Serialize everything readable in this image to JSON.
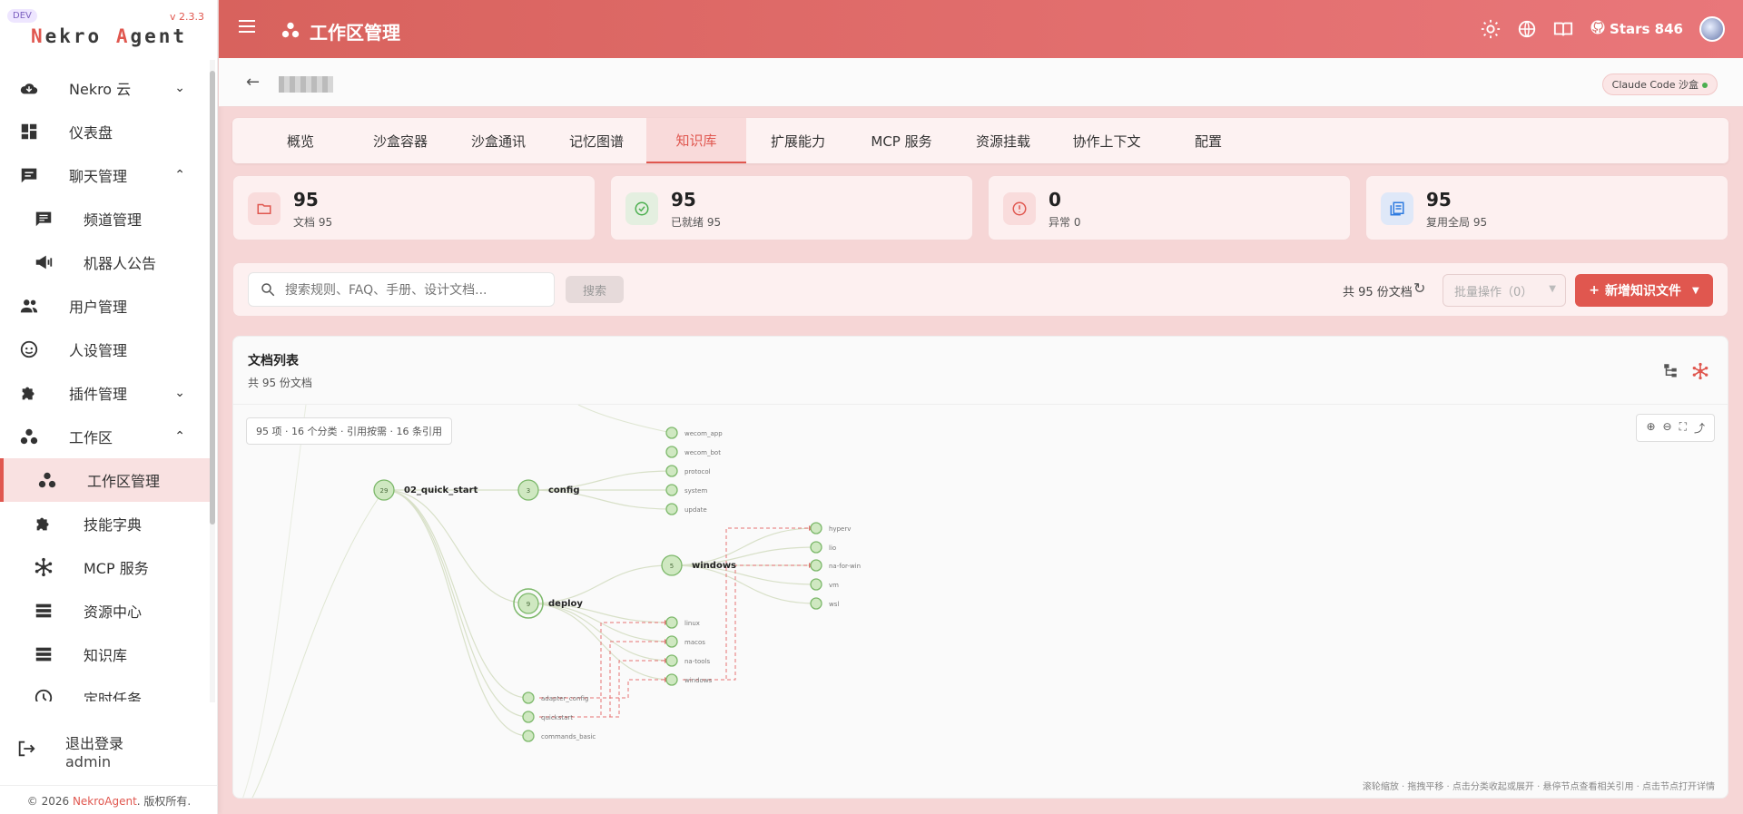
{
  "sidebar": {
    "dev_badge": "DEV",
    "version": "v 2.3.3",
    "brand_a": "N",
    "brand_b": "ekro ",
    "brand_c": "A",
    "brand_d": "gent",
    "items": [
      {
        "label": "Nekro 云",
        "icon": "cloud-download-icon",
        "chevron": "⌄"
      },
      {
        "label": "仪表盘",
        "icon": "dashboard-icon"
      },
      {
        "label": "聊天管理",
        "icon": "chat-icon",
        "chevron": "⌃"
      },
      {
        "label": "频道管理",
        "icon": "channel-icon"
      },
      {
        "label": "机器人公告",
        "icon": "megaphone-icon"
      },
      {
        "label": "用户管理",
        "icon": "users-icon"
      },
      {
        "label": "人设管理",
        "icon": "face-icon"
      },
      {
        "label": "插件管理",
        "icon": "puzzle-icon",
        "chevron": "⌄"
      },
      {
        "label": "工作区",
        "icon": "workspace-icon",
        "chevron": "⌃"
      },
      {
        "label": "工作区管理",
        "icon": "workspace-icon"
      },
      {
        "label": "技能字典",
        "icon": "puzzle-icon"
      },
      {
        "label": "MCP 服务",
        "icon": "hub-icon"
      },
      {
        "label": "资源中心",
        "icon": "list-icon"
      },
      {
        "label": "知识库",
        "icon": "list-icon"
      },
      {
        "label": "定时任务",
        "icon": "clock-icon"
      }
    ],
    "logout_label": "退出登录",
    "user": "admin",
    "footer_prefix": "© 2026 ",
    "footer_brand": "NekroAgent",
    "footer_suffix": ". 版权所有."
  },
  "header": {
    "title": "工作区管理",
    "stars": "Stars 846"
  },
  "subbar": {
    "badge": "Claude Code 沙盒"
  },
  "tabs": [
    "概览",
    "沙盒容器",
    "沙盒通讯",
    "记忆图谱",
    "知识库",
    "扩展能力",
    "MCP 服务",
    "资源挂载",
    "协作上下文",
    "配置"
  ],
  "active_tab": 4,
  "stats": [
    {
      "num": "95",
      "sub": "文档 95",
      "color": "#e0574f",
      "bg": "#f9dcdc"
    },
    {
      "num": "95",
      "sub": "已就绪 95",
      "color": "#4caf50",
      "bg": "#e4efe0"
    },
    {
      "num": "0",
      "sub": "异常 0",
      "color": "#e0574f",
      "bg": "#f9dcdc"
    },
    {
      "num": "95",
      "sub": "复用全局 95",
      "color": "#2f7be0",
      "bg": "#dfe8f8"
    }
  ],
  "search": {
    "placeholder": "搜索规则、FAQ、手册、设计文档...",
    "button": "搜索",
    "count": "共 95 份文档",
    "batch": "批量操作（0）",
    "new_button": "新增知识文件"
  },
  "panel": {
    "title": "文档列表",
    "subtitle": "共 95 份文档",
    "chip": "95 项 · 16 个分类 · 引用按需 · 16 条引用",
    "hint": "滚轮缩放 · 拖拽平移 · 点击分类收起或展开 · 悬停节点查看相关引用 · 点击节点打开详情"
  },
  "graph": {
    "nodes": [
      {
        "id": "quick",
        "label": "02_quick_start",
        "count": "29",
        "big": true
      },
      {
        "id": "config",
        "label": "config",
        "count": "3",
        "big": true
      },
      {
        "id": "windows",
        "label": "windows",
        "count": "5",
        "big": true
      },
      {
        "id": "deploy",
        "label": "deploy",
        "count": "9",
        "big": true,
        "ring": true
      },
      {
        "id": "wecom_app",
        "label": "wecom_app"
      },
      {
        "id": "wecom_bot",
        "label": "wecom_bot"
      },
      {
        "id": "protocol",
        "label": "protocol"
      },
      {
        "id": "system",
        "label": "system"
      },
      {
        "id": "update",
        "label": "update"
      },
      {
        "id": "hyperv",
        "label": "hyperv"
      },
      {
        "id": "lio",
        "label": "lio"
      },
      {
        "id": "na-for-win",
        "label": "na-for-win"
      },
      {
        "id": "vm",
        "label": "vm"
      },
      {
        "id": "wsl",
        "label": "wsl"
      },
      {
        "id": "linux",
        "label": "linux"
      },
      {
        "id": "macos",
        "label": "macos"
      },
      {
        "id": "na-tools",
        "label": "na-tools"
      },
      {
        "id": "windows2",
        "label": "windows"
      },
      {
        "id": "adapter_config",
        "label": "adapter_config"
      },
      {
        "id": "quickstart",
        "label": "quickstart"
      },
      {
        "id": "commands_basic",
        "label": "commands_basic"
      }
    ],
    "edges": [
      [
        "quick",
        "config"
      ],
      [
        "quick",
        "deploy"
      ],
      [
        "quick",
        "adapter_config"
      ],
      [
        "quick",
        "quickstart"
      ],
      [
        "quick",
        "commands_basic"
      ],
      [
        "config",
        "protocol"
      ],
      [
        "config",
        "system"
      ],
      [
        "config",
        "update"
      ],
      [
        "deploy",
        "windows"
      ],
      [
        "deploy",
        "linux"
      ],
      [
        "deploy",
        "macos"
      ],
      [
        "deploy",
        "na-tools"
      ],
      [
        "deploy",
        "windows2"
      ],
      [
        "windows",
        "hyperv"
      ],
      [
        "windows",
        "lio"
      ],
      [
        "windows",
        "na-for-win"
      ],
      [
        "windows",
        "vm"
      ],
      [
        "windows",
        "wsl"
      ]
    ],
    "refs": [
      [
        "windows2",
        "hyperv"
      ],
      [
        "windows2",
        "na-for-win"
      ],
      [
        "quickstart",
        "linux"
      ],
      [
        "quickstart",
        "macos"
      ],
      [
        "quickstart",
        "na-tools"
      ],
      [
        "adapter_config",
        "windows2"
      ]
    ],
    "colors": {
      "node": "#cfe8c1",
      "stroke": "#7cb86a",
      "edge": "#d8e0c8",
      "ref": "#e57373"
    }
  }
}
